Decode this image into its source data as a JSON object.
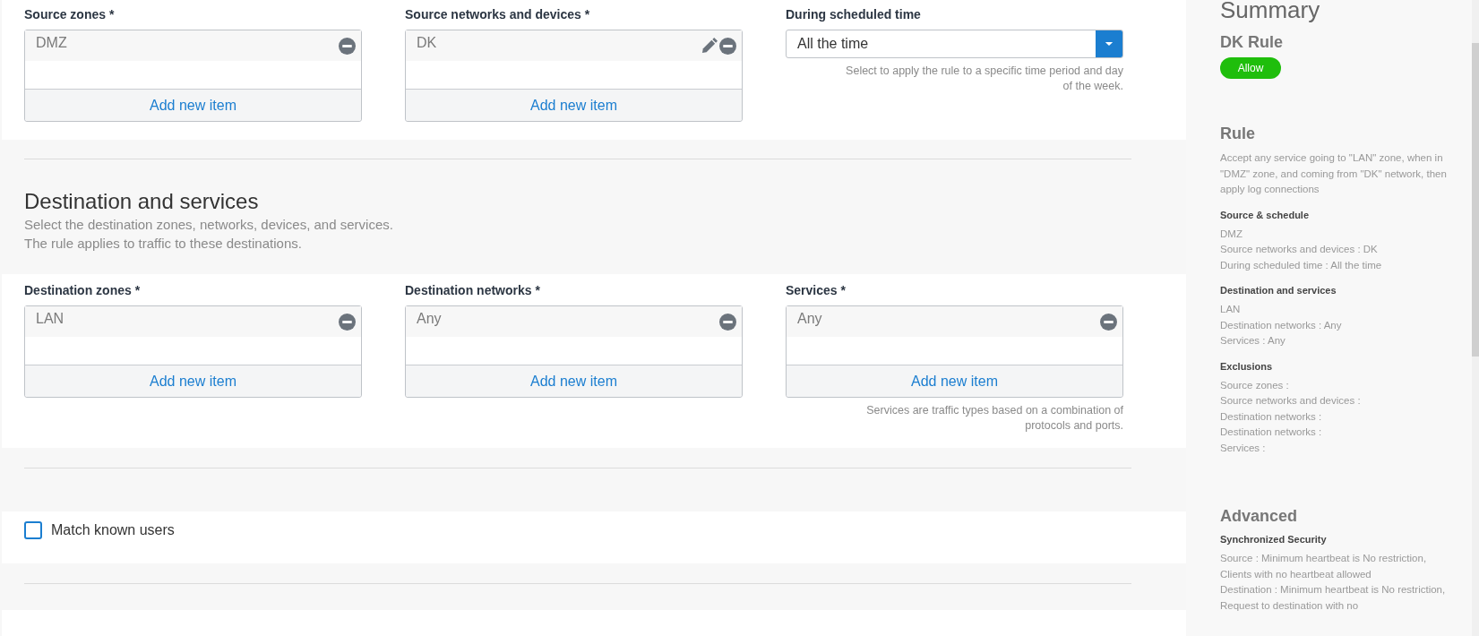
{
  "source_fields": [
    {
      "kind": "list",
      "label": "Source zones *",
      "items": [
        {
          "text": "DMZ",
          "editable": false
        }
      ],
      "add_label": "Add new item"
    },
    {
      "kind": "list",
      "label": "Source networks and devices *",
      "items": [
        {
          "text": "DK",
          "editable": true
        }
      ],
      "add_label": "Add new item"
    },
    {
      "kind": "dropdown",
      "label": "During scheduled time",
      "value": "All the time",
      "help": "Select to apply the rule to a specific time period and day of the week."
    }
  ],
  "destination": {
    "title": "Destination and services",
    "description": [
      "Select the destination zones, networks, devices, and services.",
      "The rule applies to traffic to these destinations."
    ],
    "fields": [
      {
        "kind": "list",
        "label": "Destination zones *",
        "items": [
          {
            "text": "LAN",
            "editable": false
          }
        ],
        "add_label": "Add new item"
      },
      {
        "kind": "list",
        "label": "Destination networks *",
        "items": [
          {
            "text": "Any",
            "editable": false
          }
        ],
        "add_label": "Add new item"
      },
      {
        "kind": "list",
        "label": "Services *",
        "items": [
          {
            "text": "Any",
            "editable": false
          }
        ],
        "add_label": "Add new item",
        "help": "Services are traffic types based on a combination of protocols and ports."
      }
    ]
  },
  "match_known_users": {
    "label": "Match known users",
    "checked": false
  },
  "summary": {
    "title": "Summary",
    "rule_name": "DK Rule",
    "action": "Allow",
    "sections": [
      {
        "title": "Rule",
        "text": "Accept any service going to \"LAN\" zone, when in \"DMZ\" zone, and coming from \"DK\" network, then apply log connections",
        "groups": [
          {
            "title": "Source & schedule",
            "lines": [
              "DMZ",
              "Source networks and devices : DK",
              "During scheduled time : All the time"
            ]
          },
          {
            "title": "Destination and services",
            "lines": [
              "LAN",
              "Destination networks : Any",
              "Services : Any"
            ]
          },
          {
            "title": "Exclusions",
            "lines": [
              "Source zones :",
              "Source networks and devices :",
              "Destination networks :",
              "Destination networks :",
              "Services :"
            ]
          }
        ]
      },
      {
        "title": "Advanced",
        "groups": [
          {
            "title": "Synchronized Security",
            "lines": [
              "Source : Minimum heartbeat is No restriction, Clients with no heartbeat allowed",
              "Destination : Minimum heartbeat is No restriction, Request to destination with no"
            ]
          }
        ]
      }
    ]
  }
}
